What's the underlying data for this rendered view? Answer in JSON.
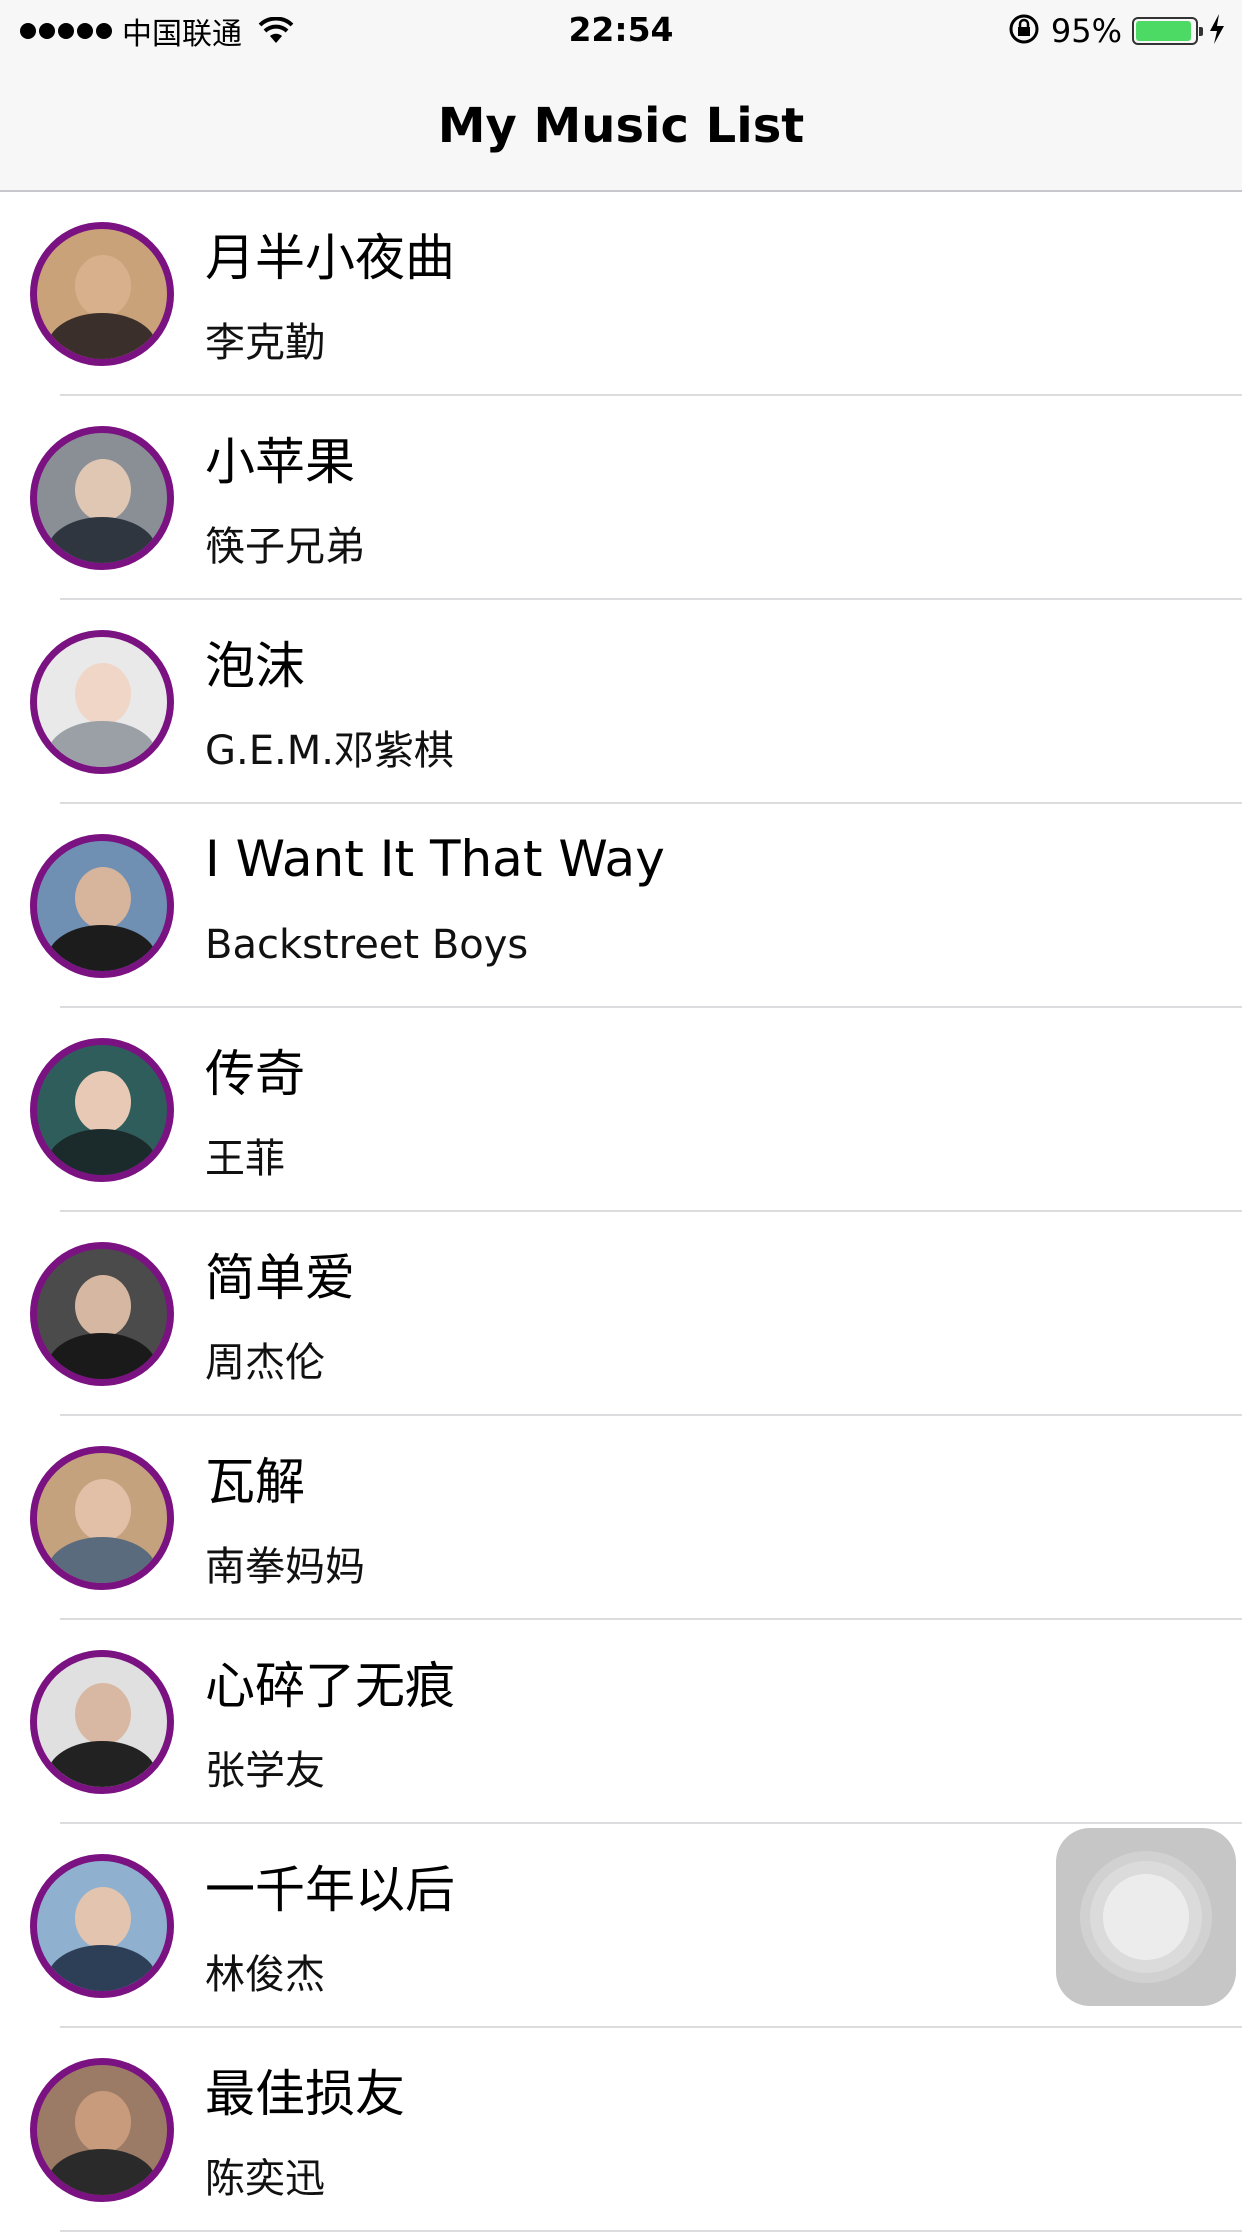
{
  "status_bar": {
    "carrier": "中国联通",
    "time": "22:54",
    "battery_percent": "95%",
    "battery_level": 0.95,
    "battery_color": "#4cd964",
    "icons": [
      "signal-dots-icon",
      "wifi-icon",
      "orientation-lock-icon",
      "battery-icon",
      "charging-bolt-icon"
    ]
  },
  "nav": {
    "title": "My Music List"
  },
  "songs": [
    {
      "title": "月半小夜曲",
      "artist": "李克勤"
    },
    {
      "title": "小苹果",
      "artist": "筷子兄弟"
    },
    {
      "title": "泡沫",
      "artist": "G.E.M.邓紫棋"
    },
    {
      "title": "I Want It That Way",
      "artist": "Backstreet Boys"
    },
    {
      "title": "传奇",
      "artist": "王菲"
    },
    {
      "title": "简单爱",
      "artist": "周杰伦"
    },
    {
      "title": "瓦解",
      "artist": "南拳妈妈"
    },
    {
      "title": "心碎了无痕",
      "artist": "张学友"
    },
    {
      "title": "一千年以后",
      "artist": "林俊杰"
    },
    {
      "title": "最佳损友",
      "artist": "陈奕迅"
    }
  ],
  "colors": {
    "avatar_border": "#7a1281",
    "bar_background": "#f7f7f7",
    "separator": "#dcdcdf"
  },
  "assistive_touch": {
    "icon": "assistive-touch-icon"
  }
}
